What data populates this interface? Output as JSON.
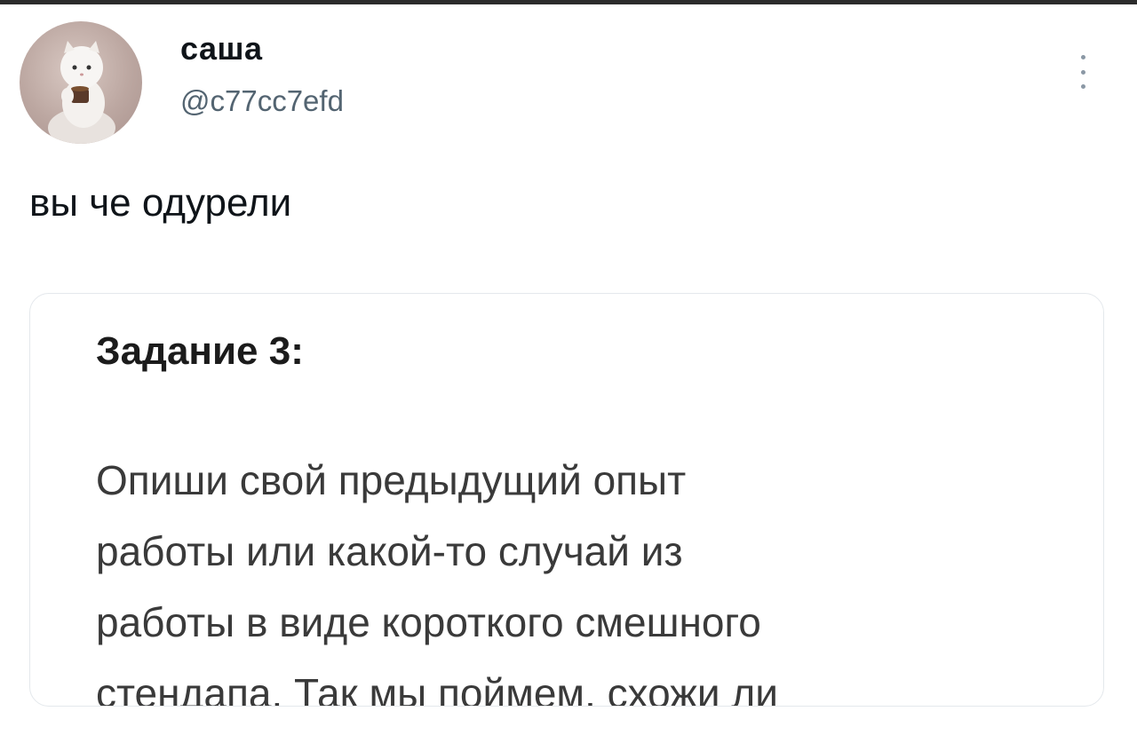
{
  "tweet": {
    "author": {
      "display_name": "саша",
      "handle": "@c77cc7efd"
    },
    "text": "вы че одурели",
    "more_icon": "more-vertical-icon"
  },
  "media": {
    "title": "Задание 3:",
    "body_lines": [
      "Опиши свой предыдущий опыт",
      "работы или какой-то случай из",
      "работы в виде короткого смешного",
      "стендапа. Так мы поймем, схожи ли"
    ]
  }
}
